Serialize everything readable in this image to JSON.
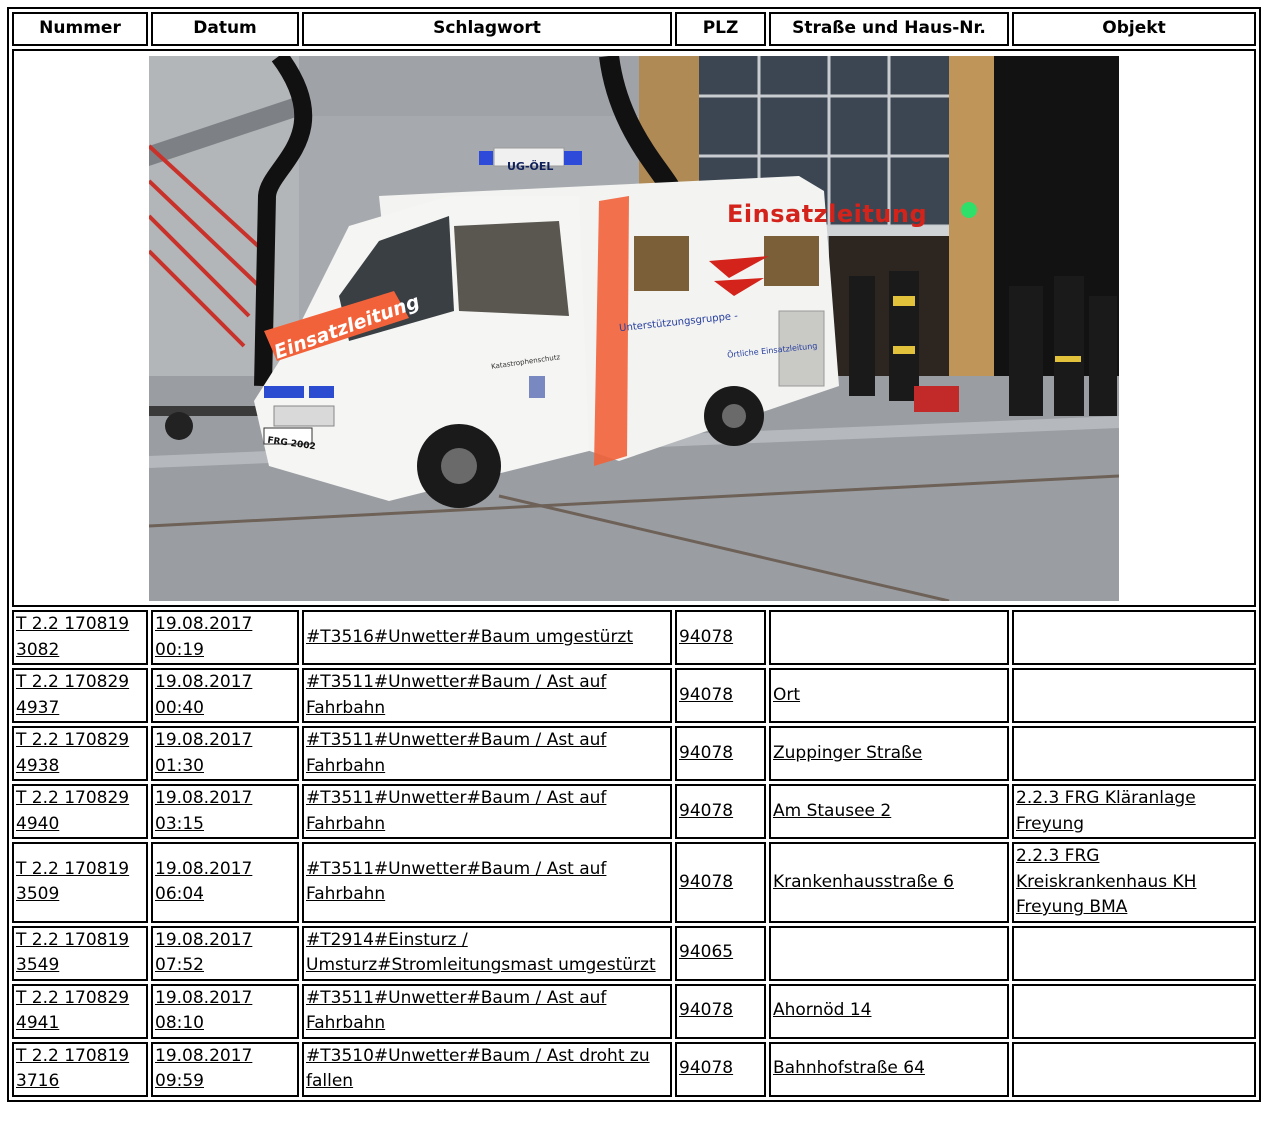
{
  "columns": {
    "nummer": "Nummer",
    "datum": "Datum",
    "schlagwort": "Schlagwort",
    "plz": "PLZ",
    "strasse": "Straße und Haus-Nr.",
    "objekt": "Objekt"
  },
  "photo": {
    "roof_sign": "UG-ÖEL",
    "side_banner": "Einsatzleitung",
    "hood_banner": "Einsatzleitung",
    "side_lettering": "Unterstützungsgruppe -",
    "side_lettering_2": "Örtliche Einsatzleitung",
    "door_lettering": "Katastrophenschutz",
    "plate": "FRG 2002",
    "colors": {
      "accent_orange": "#f2623a",
      "banner_red": "#d3231b",
      "status_light": "#2ee06a",
      "floor": "#9a9ea3"
    }
  },
  "rows": [
    {
      "nr_a": "T 2.2 170819",
      "nr_b": "3082",
      "date": "19.08.2017",
      "time": "00:19",
      "kw_a": "#T3516#Unwetter#Baum umgestürzt",
      "kw_b": "",
      "plz": "94078",
      "street": "",
      "obj_a": "",
      "obj_b": "",
      "obj_c": ""
    },
    {
      "nr_a": "T 2.2 170829",
      "nr_b": "4937",
      "date": "19.08.2017",
      "time": "00:40",
      "kw_a": "#T3511#Unwetter#Baum / Ast auf",
      "kw_b": "Fahrbahn",
      "plz": "94078",
      "street": "Ort",
      "obj_a": "",
      "obj_b": "",
      "obj_c": ""
    },
    {
      "nr_a": "T 2.2 170829",
      "nr_b": "4938",
      "date": "19.08.2017",
      "time": "01:30",
      "kw_a": "#T3511#Unwetter#Baum / Ast auf",
      "kw_b": "Fahrbahn",
      "plz": "94078",
      "street": "Zuppinger Straße",
      "obj_a": "",
      "obj_b": "",
      "obj_c": ""
    },
    {
      "nr_a": "T 2.2 170829",
      "nr_b": "4940",
      "date": "19.08.2017",
      "time": "03:15",
      "kw_a": "#T3511#Unwetter#Baum / Ast auf",
      "kw_b": "Fahrbahn",
      "plz": "94078",
      "street": "Am Stausee 2",
      "obj_a": "2.2.3 FRG Kläranlage",
      "obj_b": "Freyung",
      "obj_c": ""
    },
    {
      "nr_a": "T 2.2 170819",
      "nr_b": "3509",
      "date": "19.08.2017",
      "time": "06:04",
      "kw_a": "#T3511#Unwetter#Baum / Ast auf",
      "kw_b": "Fahrbahn",
      "plz": "94078",
      "street": "Krankenhausstraße 6",
      "obj_a": "2.2.3 FRG",
      "obj_b": "Kreiskrankenhaus KH",
      "obj_c": "Freyung BMA"
    },
    {
      "nr_a": "T 2.2 170819",
      "nr_b": "3549",
      "date": "19.08.2017",
      "time": "07:52",
      "kw_a": "#T2914#Einsturz /",
      "kw_b": "Umsturz#Stromleitungsmast umgestürzt",
      "plz": "94065",
      "street": "",
      "obj_a": "",
      "obj_b": "",
      "obj_c": ""
    },
    {
      "nr_a": "T 2.2 170829",
      "nr_b": "4941",
      "date": "19.08.2017",
      "time": "08:10",
      "kw_a": "#T3511#Unwetter#Baum / Ast auf",
      "kw_b": "Fahrbahn",
      "plz": "94078",
      "street": "Ahornöd 14",
      "obj_a": "",
      "obj_b": "",
      "obj_c": ""
    },
    {
      "nr_a": "T 2.2 170819",
      "nr_b": "3716",
      "date": "19.08.2017",
      "time": "09:59",
      "kw_a": "#T3510#Unwetter#Baum / Ast droht zu",
      "kw_b": "fallen",
      "plz": "94078",
      "street": "Bahnhofstraße 64",
      "obj_a": "",
      "obj_b": "",
      "obj_c": ""
    }
  ]
}
